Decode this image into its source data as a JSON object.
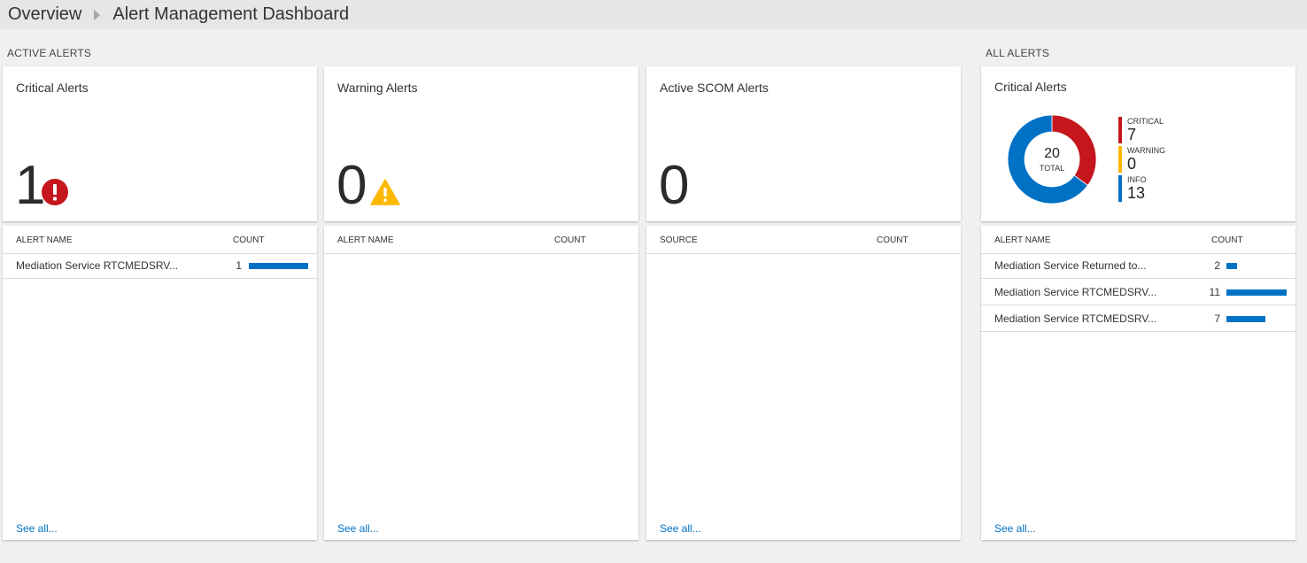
{
  "breadcrumb": {
    "root": "Overview",
    "current": "Alert Management Dashboard"
  },
  "sections": {
    "active": "ACTIVE ALERTS",
    "all": "ALL ALERTS"
  },
  "colors": {
    "critical": "#c4161c",
    "warning": "#fcb900",
    "info": "#0072c6",
    "link": "#0072c6"
  },
  "tiles": {
    "critical": {
      "title": "Critical Alerts",
      "value": "1",
      "icon": "critical-exclamation-icon"
    },
    "warning": {
      "title": "Warning Alerts",
      "value": "0",
      "icon": "warning-triangle-icon"
    },
    "scom": {
      "title": "Active SCOM Alerts",
      "value": "0"
    },
    "all": {
      "title": "Critical Alerts",
      "total_value": "20",
      "total_label": "TOTAL",
      "legend": [
        {
          "label": "CRITICAL",
          "value": "7",
          "count": 7
        },
        {
          "label": "WARNING",
          "value": "0",
          "count": 0
        },
        {
          "label": "INFO",
          "value": "13",
          "count": 13
        }
      ]
    }
  },
  "lists": {
    "critical": {
      "col_name": "ALERT NAME",
      "col_count": "COUNT",
      "rows": [
        {
          "name": "Mediation Service RTCMEDSRV...",
          "count": "1",
          "fraction": 1.0
        }
      ],
      "see_all": "See all..."
    },
    "warning": {
      "col_name": "ALERT NAME",
      "col_count": "COUNT",
      "rows": [],
      "see_all": "See all..."
    },
    "scom": {
      "col_name": "SOURCE",
      "col_count": "COUNT",
      "rows": [],
      "see_all": "See all..."
    },
    "all": {
      "col_name": "ALERT NAME",
      "col_count": "COUNT",
      "rows": [
        {
          "name": "Mediation Service Returned to...",
          "count": "2",
          "fraction": 0.18
        },
        {
          "name": "Mediation Service RTCMEDSRV...",
          "count": "11",
          "fraction": 1.0
        },
        {
          "name": "Mediation Service RTCMEDSRV...",
          "count": "7",
          "fraction": 0.64
        }
      ],
      "see_all": "See all..."
    }
  }
}
